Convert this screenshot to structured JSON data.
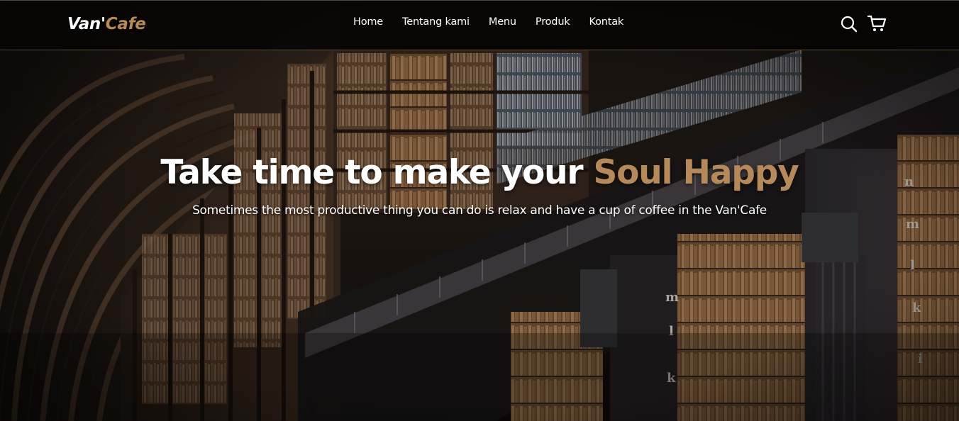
{
  "brand": {
    "name_part1": "Van'",
    "name_part2": "Cafe"
  },
  "nav": {
    "links": [
      {
        "label": "Home"
      },
      {
        "label": "Tentang kami"
      },
      {
        "label": "Menu"
      },
      {
        "label": "Produk"
      },
      {
        "label": "Kontak"
      }
    ],
    "icons": [
      "search-icon",
      "shopping-cart-icon"
    ]
  },
  "hero": {
    "title_main": "Take time to make your",
    "title_accent": "Soul Happy",
    "subtitle": "Sometimes the most productive thing you can do is relax and have a cup of coffee in the Van'Cafe",
    "background_description_icon": "library-bookshelves-image"
  },
  "colors": {
    "accent": "#b6895b",
    "navbar_bg": "#070605",
    "text": "#ffffff"
  }
}
